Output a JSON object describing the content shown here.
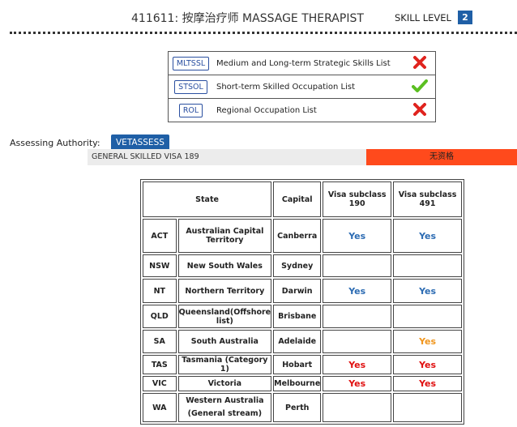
{
  "header": {
    "title": "411611: 按摩治疗师 MASSAGE THERAPIST",
    "skill_level_label": "SKILL LEVEL",
    "skill_level_value": "2"
  },
  "occupation_lists": [
    {
      "code": "MLTSSL",
      "name": "Medium and Long-term Strategic Skills List",
      "status_icon": "cross-icon",
      "status": "not-listed"
    },
    {
      "code": "STSOL",
      "name": "Short-term Skilled Occupation List",
      "status_icon": "check-icon",
      "status": "listed"
    },
    {
      "code": "ROL",
      "name": "Regional Occupation List",
      "status_icon": "cross-icon",
      "status": "not-listed"
    }
  ],
  "assessing": {
    "label": "Assessing Authority:",
    "authority": "VETASSESS"
  },
  "visa_189": {
    "label": "GENERAL SKILLED VISA 189",
    "status": "无资格"
  },
  "state_table": {
    "headers": [
      "State",
      "Capital",
      "Visa subclass 190",
      "Visa subclass 491"
    ],
    "rows": [
      {
        "abbr": "ACT",
        "state": "Australian Capital Territory",
        "capital": "Canberra",
        "v190": "Yes",
        "v491": "Yes",
        "v190_color": "blue",
        "v491_color": "blue"
      },
      {
        "abbr": "NSW",
        "state": "New South Wales",
        "capital": "Sydney",
        "v190": "",
        "v491": "",
        "v190_color": "",
        "v491_color": ""
      },
      {
        "abbr": "NT",
        "state": "Northern Territory",
        "capital": "Darwin",
        "v190": "Yes",
        "v491": "Yes",
        "v190_color": "blue",
        "v491_color": "blue"
      },
      {
        "abbr": "QLD",
        "state": "Queensland(Offshore list)",
        "capital": "Brisbane",
        "v190": "",
        "v491": "",
        "v190_color": "",
        "v491_color": ""
      },
      {
        "abbr": "SA",
        "state": "South Australia",
        "capital": "Adelaide",
        "v190": "",
        "v491": "Yes",
        "v190_color": "",
        "v491_color": "orange"
      },
      {
        "abbr": "TAS",
        "state": "Tasmania (Category 1)",
        "capital": "Hobart",
        "v190": "Yes",
        "v491": "Yes",
        "v190_color": "red",
        "v491_color": "red"
      },
      {
        "abbr": "VIC",
        "state": "Victoria",
        "capital": "Melbourne",
        "v190": "Yes",
        "v491": "Yes",
        "v190_color": "red",
        "v491_color": "red"
      },
      {
        "abbr": "WA",
        "state": "Western Australia",
        "state_line2": "(General stream)",
        "capital": "Perth",
        "v190": "",
        "v491": "",
        "v190_color": "",
        "v491_color": ""
      }
    ]
  },
  "colors": {
    "badge_blue": "#1f5fa6",
    "yes_blue": "#2d6cb3",
    "yes_red": "#e01010",
    "yes_orange": "#f0961e",
    "status_bar_red": "#ff4a1c",
    "check_green": "#5bbf21",
    "cross_red": "#e0231e"
  }
}
